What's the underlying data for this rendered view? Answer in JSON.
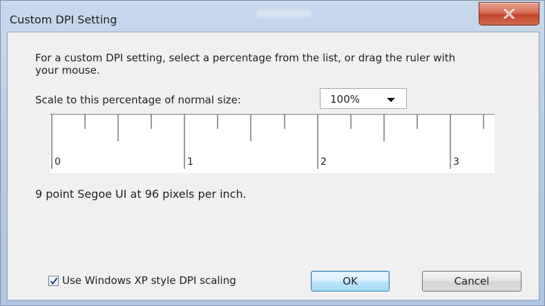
{
  "window": {
    "title": "Custom DPI Setting",
    "close_icon": "close-icon"
  },
  "dialog": {
    "description": "For a custom DPI setting, select a percentage from the list, or drag the ruler with your mouse.",
    "scale_label": "Scale to this percentage of normal size:",
    "scale_value": "100%",
    "ruler": {
      "numbers": [
        "0",
        "1",
        "2",
        "3"
      ]
    },
    "info_text": "9 point Segoe UI at 96 pixels per inch.",
    "xp_scaling": {
      "label": "Use Windows XP style DPI scaling",
      "checked": true
    },
    "ok_label": "OK",
    "cancel_label": "Cancel"
  },
  "colors": {
    "ok_border": "#3c7fb1",
    "close_button": "#c4462c"
  }
}
